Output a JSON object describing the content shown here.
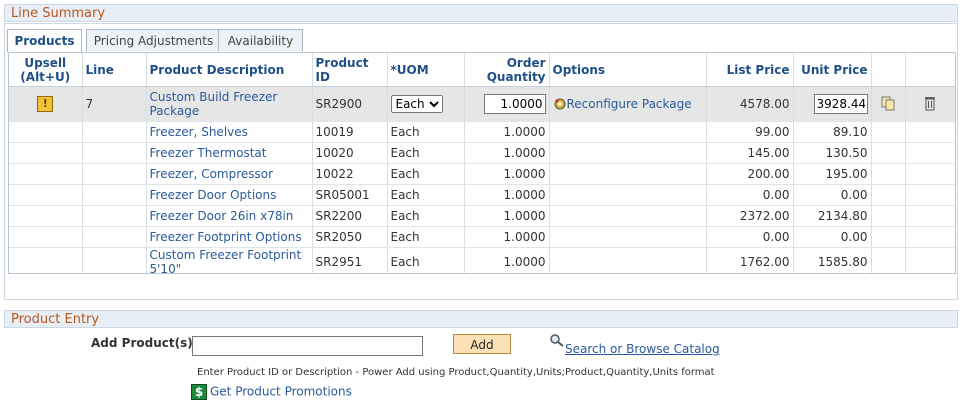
{
  "sections": {
    "line_summary": "Line Summary",
    "product_entry": "Product Entry"
  },
  "tabs": [
    {
      "label": "Products",
      "active": true
    },
    {
      "label": "Pricing Adjustments",
      "active": false
    },
    {
      "label": "Availability",
      "active": false
    }
  ],
  "headers": {
    "upsell": "Upsell (Alt+U)",
    "line": "Line",
    "description": "Product Description",
    "product_id": "Product ID",
    "uom": "*UOM",
    "qty": "Order Quantity",
    "options": "Options",
    "list_price": "List Price",
    "unit_price": "Unit Price"
  },
  "selected_row": {
    "line": "7",
    "description": "Custom Build Freezer Package",
    "product_id": "SR2900",
    "uom": "Each",
    "qty": "1.0000",
    "options": "Reconfigure Package",
    "list_price": "4578.00",
    "unit_price": "3928.44"
  },
  "rows": [
    {
      "description": "Freezer, Shelves",
      "product_id": "10019",
      "uom": "Each",
      "qty": "1.0000",
      "list_price": "99.00",
      "unit_price": "89.10"
    },
    {
      "description": "Freezer Thermostat",
      "product_id": "10020",
      "uom": "Each",
      "qty": "1.0000",
      "list_price": "145.00",
      "unit_price": "130.50"
    },
    {
      "description": "Freezer, Compressor",
      "product_id": "10022",
      "uom": "Each",
      "qty": "1.0000",
      "list_price": "200.00",
      "unit_price": "195.00"
    },
    {
      "description": "Freezer Door Options",
      "product_id": "SR05001",
      "uom": "Each",
      "qty": "1.0000",
      "list_price": "0.00",
      "unit_price": "0.00"
    },
    {
      "description": "Freezer Door 26in x78in",
      "product_id": "SR2200",
      "uom": "Each",
      "qty": "1.0000",
      "list_price": "2372.00",
      "unit_price": "2134.80"
    },
    {
      "description": "Freezer Footprint Options",
      "product_id": "SR2050",
      "uom": "Each",
      "qty": "1.0000",
      "list_price": "0.00",
      "unit_price": "0.00"
    },
    {
      "description": "Custom Freezer Footprint 5'10\"",
      "product_id": "SR2951",
      "uom": "Each",
      "qty": "1.0000",
      "list_price": "1762.00",
      "unit_price": "1585.80"
    }
  ],
  "product_entry": {
    "add_label": "Add Product(s)",
    "add_value": "",
    "add_button": "Add",
    "search_link": "Search or Browse Catalog",
    "help_text": "Enter Product ID or Description - Power Add using Product,Quantity,Units;Product,Quantity,Units format",
    "promotions_link": "Get Product Promotions"
  },
  "icons": {
    "warning": "warning-icon",
    "reconfigure": "reconfigure-icon",
    "copy": "copy-icon",
    "delete": "trash-icon",
    "search": "magnifier-icon",
    "promo": "dollar-icon"
  }
}
